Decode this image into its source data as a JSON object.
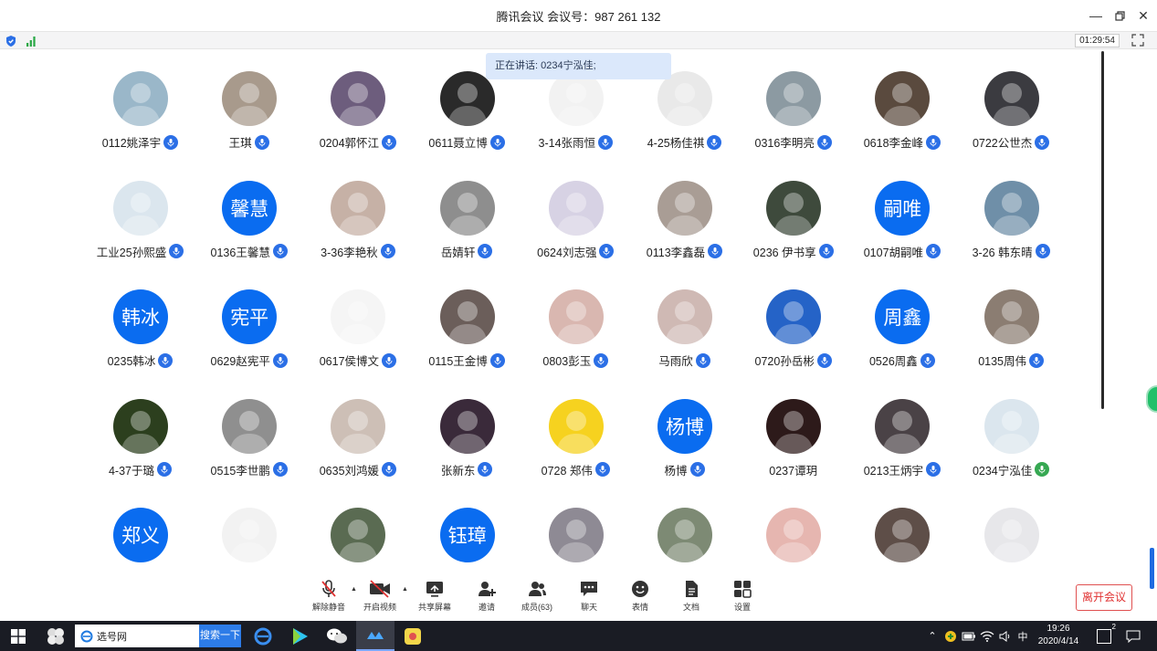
{
  "window": {
    "title": "腾讯会议 会议号：987 261 132"
  },
  "info": {
    "timer": "01:29:54"
  },
  "speaking": {
    "text": "正在讲话: 0234宁泓佳;"
  },
  "participants": [
    {
      "name": "0112姚泽宇",
      "initials": "",
      "bg": "#9ab7c9",
      "mic": "blue"
    },
    {
      "name": "王琪",
      "initials": "",
      "bg": "#a89a8c",
      "mic": "blue"
    },
    {
      "name": "0204郭怀江",
      "initials": "",
      "bg": "#6d5d7d",
      "mic": "blue"
    },
    {
      "name": "0611聂立博",
      "initials": "",
      "bg": "#2a2a2a",
      "mic": "blue"
    },
    {
      "name": "3-14张雨恒",
      "initials": "",
      "bg": "#f2f2f2",
      "mic": "blue"
    },
    {
      "name": "4-25杨佳祺",
      "initials": "",
      "bg": "#e9e9e9",
      "mic": "blue"
    },
    {
      "name": "0316李明亮",
      "initials": "",
      "bg": "#8c9aa2",
      "mic": "blue"
    },
    {
      "name": "0618李金峰",
      "initials": "",
      "bg": "#5a4a3e",
      "mic": "blue"
    },
    {
      "name": "0722公世杰",
      "initials": "",
      "bg": "#3b3b40",
      "mic": "blue"
    },
    {
      "name": "工业25孙熙盛",
      "initials": "",
      "bg": "#dbe6ee",
      "mic": "blue"
    },
    {
      "name": "0136王馨慧",
      "initials": "馨慧",
      "bg": "#0a6cf0",
      "mic": "blue"
    },
    {
      "name": "3-36李艳秋",
      "initials": "",
      "bg": "#c6b1a6",
      "mic": "blue"
    },
    {
      "name": "岳婧轩",
      "initials": "",
      "bg": "#8e8e8e",
      "mic": "blue"
    },
    {
      "name": "0624刘志强",
      "initials": "",
      "bg": "#d7d2e4",
      "mic": "blue"
    },
    {
      "name": "0113李鑫磊",
      "initials": "",
      "bg": "#a99d95",
      "mic": "blue"
    },
    {
      "name": "0236 伊书享",
      "initials": "",
      "bg": "#3e4a3c",
      "mic": "blue"
    },
    {
      "name": "0107胡嗣唯",
      "initials": "嗣唯",
      "bg": "#0a6cf0",
      "mic": "blue"
    },
    {
      "name": "3-26 韩东晴",
      "initials": "",
      "bg": "#6f8fa8",
      "mic": "blue"
    },
    {
      "name": "0235韩冰",
      "initials": "韩冰",
      "bg": "#0a6cf0",
      "mic": "blue"
    },
    {
      "name": "0629赵宪平",
      "initials": "宪平",
      "bg": "#0a6cf0",
      "mic": "blue"
    },
    {
      "name": "0617侯博文",
      "initials": "",
      "bg": "#f5f5f5",
      "mic": "blue"
    },
    {
      "name": "0115王金博",
      "initials": "",
      "bg": "#6b5e5a",
      "mic": "blue"
    },
    {
      "name": "0803彭玉",
      "initials": "",
      "bg": "#d9b7b0",
      "mic": "blue"
    },
    {
      "name": "马雨欣",
      "initials": "",
      "bg": "#cfb9b4",
      "mic": "blue"
    },
    {
      "name": "0720孙岳彬",
      "initials": "",
      "bg": "#2563c7",
      "mic": "blue"
    },
    {
      "name": "0526周鑫",
      "initials": "周鑫",
      "bg": "#0a6cf0",
      "mic": "blue"
    },
    {
      "name": "0135周伟",
      "initials": "",
      "bg": "#8b7d72",
      "mic": "blue"
    },
    {
      "name": "4-37于璐",
      "initials": "",
      "bg": "#2c3f1e",
      "mic": "blue"
    },
    {
      "name": "0515李世鹏",
      "initials": "",
      "bg": "#8f8f8f",
      "mic": "blue"
    },
    {
      "name": "0635刘鸿媛",
      "initials": "",
      "bg": "#cdbfb6",
      "mic": "blue"
    },
    {
      "name": "张新东",
      "initials": "",
      "bg": "#3a2a3a",
      "mic": "blue"
    },
    {
      "name": "0728 郑伟",
      "initials": "",
      "bg": "#f6d21f",
      "mic": "blue"
    },
    {
      "name": "杨博",
      "initials": "杨博",
      "bg": "#0a6cf0",
      "mic": "blue"
    },
    {
      "name": "0237谭玥",
      "initials": "",
      "bg": "#2d1a1a",
      "mic": "none"
    },
    {
      "name": "0213王炳宇",
      "initials": "",
      "bg": "#4a4246",
      "mic": "blue"
    },
    {
      "name": "0234宁泓佳",
      "initials": "",
      "bg": "#dbe6ee",
      "mic": "green"
    },
    {
      "name": "",
      "initials": "郑义",
      "bg": "#0a6cf0",
      "mic": "none"
    },
    {
      "name": "",
      "initials": "",
      "bg": "#f2f2f2",
      "mic": "none"
    },
    {
      "name": "",
      "initials": "",
      "bg": "#5a6b52",
      "mic": "none"
    },
    {
      "name": "",
      "initials": "钰璋",
      "bg": "#0a6cf0",
      "mic": "none"
    },
    {
      "name": "",
      "initials": "",
      "bg": "#8e8a94",
      "mic": "none"
    },
    {
      "name": "",
      "initials": "",
      "bg": "#7d8a74",
      "mic": "none"
    },
    {
      "name": "",
      "initials": "",
      "bg": "#e6b6b0",
      "mic": "none"
    },
    {
      "name": "",
      "initials": "",
      "bg": "#5e4e48",
      "mic": "none"
    },
    {
      "name": "",
      "initials": "",
      "bg": "#e7e7ea",
      "mic": "none"
    }
  ],
  "toolbar": {
    "mute": "解除静音",
    "video": "开启视频",
    "share": "共享屏幕",
    "invite": "邀请",
    "members": "成员(63)",
    "chat": "聊天",
    "emoji": "表情",
    "docs": "文档",
    "settings": "设置"
  },
  "leave_label": "离开会议",
  "taskbar": {
    "search_text": "选号网",
    "search_button": "搜索一下",
    "ime": "中",
    "time": "19:26",
    "date": "2020/4/14",
    "notif_count": "2"
  }
}
